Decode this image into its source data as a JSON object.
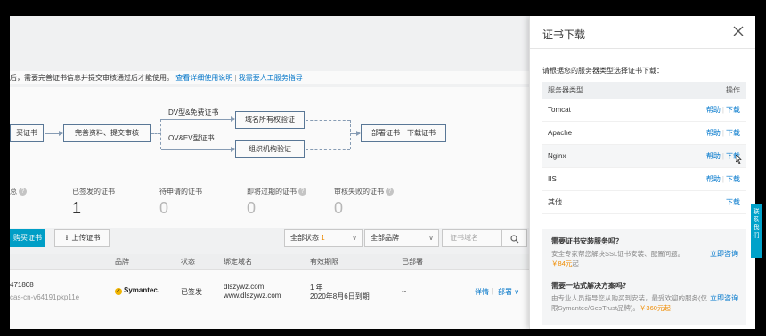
{
  "notice": {
    "text": "后，需要完善证书信息并提交审核通过后才能使用。",
    "link1": "查看详细使用说明",
    "link2": "我需要人工服务指导"
  },
  "flow": {
    "buy": "买证书",
    "complete": "完善资料、提交审核",
    "dv_label": "DV型&免费证书",
    "ov_label": "OV&EV型证书",
    "domain_verify": "域名所有权验证",
    "org_verify": "组织机构验证",
    "deploy": "部署证书　下载证书"
  },
  "stats": [
    {
      "label": "总",
      "value": ""
    },
    {
      "label": "已签发的证书",
      "value": "1"
    },
    {
      "label": "待申请的证书",
      "value": "0"
    },
    {
      "label": "即将过期的证书",
      "value": "0"
    },
    {
      "label": "审核失败的证书",
      "value": "0"
    }
  ],
  "toolbar": {
    "buy_label": "购买证书",
    "upload_label": "上传证书",
    "status_label": "全部状态",
    "status_count": "1",
    "brand_label": "全部品牌",
    "search_placeholder": "证书域名"
  },
  "table": {
    "headers": [
      "品牌",
      "状态",
      "绑定域名",
      "有效期限",
      "已部署"
    ],
    "row": {
      "id": "471808",
      "sub": "cas-cn-v64191pkp11e",
      "brand": "Symantec.",
      "status": "已签发",
      "domain1": "dlszywz.com",
      "domain2": "www.dlszywz.com",
      "valid1": "1 年",
      "valid2": "2020年8月6日到期",
      "deployed": "--",
      "action_detail": "详情",
      "action_deploy": "部署"
    }
  },
  "drawer": {
    "title": "证书下载",
    "hint": "请根据您的服务器类型选择证书下载：",
    "col_server": "服务器类型",
    "col_ops": "操作",
    "help": "帮助",
    "download": "下载",
    "servers": [
      "Tomcat",
      "Apache",
      "Nginx",
      "IIS",
      "其他"
    ],
    "svc1_q": "需要证书安装服务吗？",
    "svc1_d": "安全专家帮您解决SSL证书安装、配置问题。",
    "svc1_price": "￥84元",
    "svc1_d2": "起",
    "svc2_q": "需要一站式解决方案吗？",
    "svc2_d": "由专业人员指导您从购买到安装，最受欢迎的服务(仅限Symantec/GeoTrust品牌)。",
    "svc2_price": "￥360元起",
    "consult": "立即咨询"
  },
  "side_tab": "联系我们"
}
